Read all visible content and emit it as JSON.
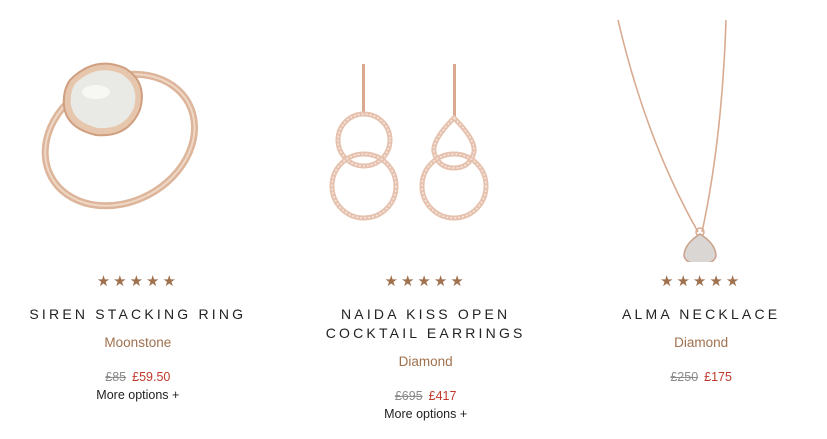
{
  "colors": {
    "star": "#a0714e",
    "variant": "#a0714e",
    "sale": "#c0392b",
    "old": "#8a8a8a"
  },
  "products": [
    {
      "image": "ring-image",
      "rating": 5,
      "title": "SIREN STACKING RING",
      "variant": "Moonstone",
      "old_price": "£85",
      "price": "£59.50",
      "more": "More options +"
    },
    {
      "image": "earrings-image",
      "rating": 5,
      "title_lines": [
        "NAIDA KISS OPEN",
        "COCKTAIL EARRINGS"
      ],
      "variant": "Diamond",
      "old_price": "£695",
      "price": "£417",
      "more": "More options +"
    },
    {
      "image": "necklace-image",
      "rating": 5,
      "title": "ALMA NECKLACE",
      "variant": "Diamond",
      "old_price": "£250",
      "price": "£175"
    }
  ]
}
